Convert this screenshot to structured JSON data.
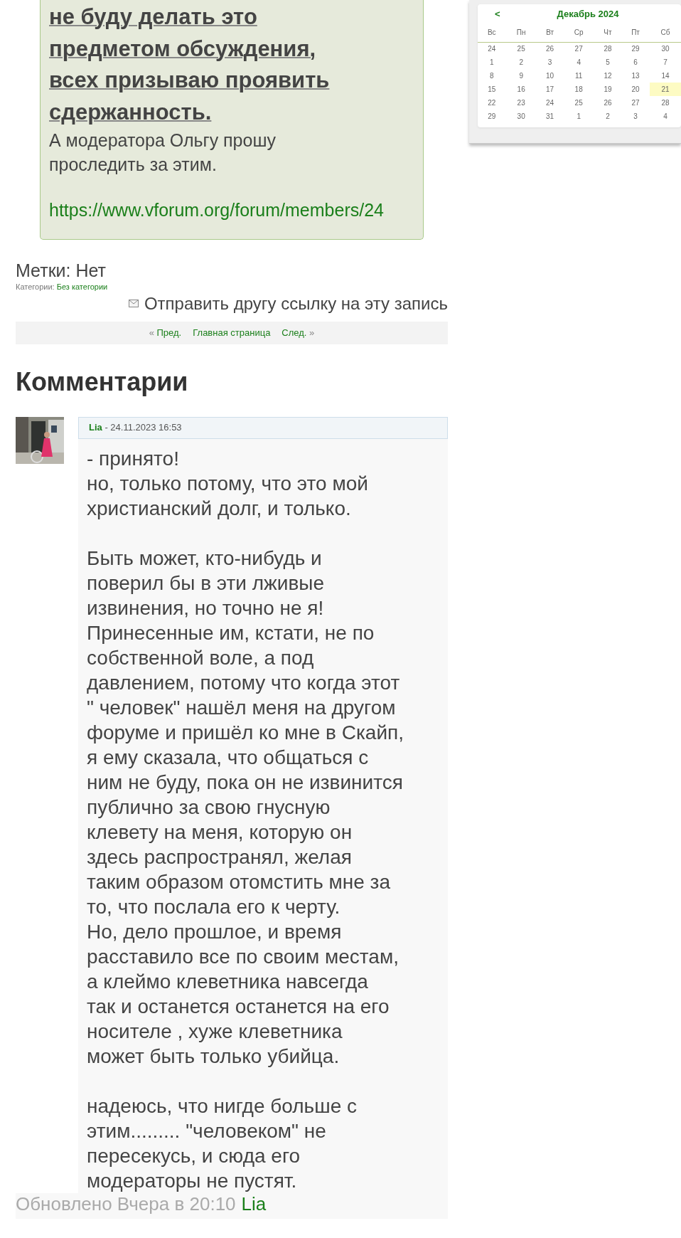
{
  "post": {
    "quote": {
      "emphasis": "не буду делать это\nпредметом обсуждения,\nвсех призываю проявить\nсдержанность.",
      "text": "А модератора Ольгу прошу\nпроследить за этим.",
      "link": "https://www.vforum.org/forum/members/24"
    },
    "tags": "Метки: Нет",
    "categories_label": "Категории:",
    "category": "Без категории",
    "send_link": "Отправить другу ссылку на эту запись",
    "nav": [
      {
        "arrow_before": "«",
        "label": "Пред."
      },
      {
        "label": "Главная страница"
      },
      {
        "arrow_after": "»",
        "label": "След."
      }
    ]
  },
  "comments_title": "Комментарии",
  "comments": [
    {
      "author": "Lia",
      "date": " - 24.11.2023 16:53",
      "paragraphs": [
        "- принято!\nно, только потому, что это мой\nхристианский долг, и только.",
        "Быть может, кто-нибудь и\nповерил бы в эти лживые\nизвинения, но точно не я!\nПринесенные им, кстати, не по\nсобственной воле, а под\nдавлением, потому что когда этот\n\" человек\" нашёл меня на другом\nфоруме и пришёл ко мне в Скайп,\nя ему сказала, что общаться с\nним не буду, пока он не извинится\nпублично за свою гнусную\nклевету на меня, которую он\nздесь распространял, желая\nтаким образом отомстить мне за\nто, что послала его к черту.\nНо, дело прошлое, и время\nрасставило все по своим местам,\nа клеймо клеветника навсегда\nтак и останется останется на его\nносителе , хуже клеветника\nможет быть только убийца.",
        "надеюсь, что нигде больше с\nэтим......... \"человеком\" не\nпересекусь, и сюда его\nмодераторы не пустят."
      ],
      "updated": "Обновлено Вчера в 20:10",
      "updated_by": "Lia"
    }
  ],
  "calendar": {
    "prev": "<",
    "title": "Декабрь 2024",
    "weekdays": [
      "Вс",
      "Пн",
      "Вт",
      "Ср",
      "Чт",
      "Пт",
      "Сб"
    ],
    "weeks": [
      [
        {
          "day": "24",
          "selected": false
        },
        {
          "day": "25",
          "selected": false
        },
        {
          "day": "26",
          "selected": false
        },
        {
          "day": "27",
          "selected": false
        },
        {
          "day": "28",
          "selected": false
        },
        {
          "day": "29",
          "selected": false
        },
        {
          "day": "30",
          "selected": false
        }
      ],
      [
        {
          "day": "1",
          "selected": false
        },
        {
          "day": "2",
          "selected": false
        },
        {
          "day": "3",
          "selected": false
        },
        {
          "day": "4",
          "selected": false
        },
        {
          "day": "5",
          "selected": false
        },
        {
          "day": "6",
          "selected": false
        },
        {
          "day": "7",
          "selected": false
        }
      ],
      [
        {
          "day": "8",
          "selected": false
        },
        {
          "day": "9",
          "selected": false
        },
        {
          "day": "10",
          "selected": false
        },
        {
          "day": "11",
          "selected": false
        },
        {
          "day": "12",
          "selected": false
        },
        {
          "day": "13",
          "selected": false
        },
        {
          "day": "14",
          "selected": false
        }
      ],
      [
        {
          "day": "15",
          "selected": false
        },
        {
          "day": "16",
          "selected": false
        },
        {
          "day": "17",
          "selected": false
        },
        {
          "day": "18",
          "selected": false
        },
        {
          "day": "19",
          "selected": false
        },
        {
          "day": "20",
          "selected": false
        },
        {
          "day": "21",
          "selected": true
        }
      ],
      [
        {
          "day": "22",
          "selected": false
        },
        {
          "day": "23",
          "selected": false
        },
        {
          "day": "24",
          "selected": false
        },
        {
          "day": "25",
          "selected": false
        },
        {
          "day": "26",
          "selected": false
        },
        {
          "day": "27",
          "selected": false
        },
        {
          "day": "28",
          "selected": false
        }
      ],
      [
        {
          "day": "29",
          "selected": false
        },
        {
          "day": "30",
          "selected": false
        },
        {
          "day": "31",
          "selected": false
        },
        {
          "day": "1",
          "selected": false
        },
        {
          "day": "2",
          "selected": false
        },
        {
          "day": "3",
          "selected": false
        },
        {
          "day": "4",
          "selected": false
        }
      ]
    ]
  }
}
